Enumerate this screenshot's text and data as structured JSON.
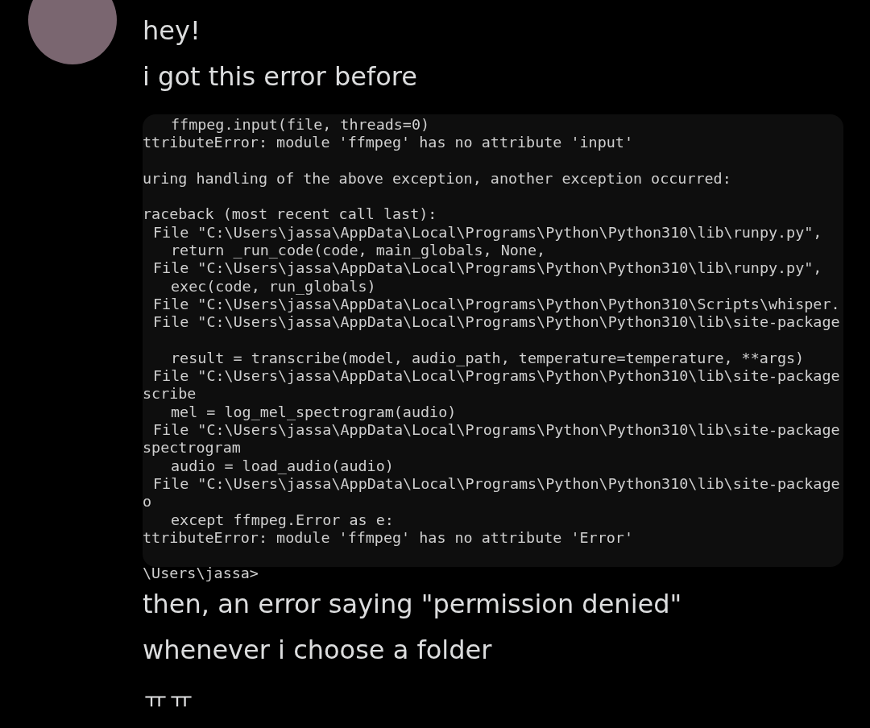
{
  "messages": [
    {
      "kind": "text",
      "text": "hey!"
    },
    {
      "kind": "text",
      "text": "i got this error before"
    },
    {
      "kind": "image",
      "lines": [
        {
          "kind": "code",
          "text": "ffmpeg.input(file, threads=0)"
        },
        {
          "kind": "plain",
          "text": "ttributeError: module 'ffmpeg' has no attribute 'input'"
        },
        {
          "kind": "blank"
        },
        {
          "kind": "plain",
          "text": "uring handling of the above exception, another exception occurred:"
        },
        {
          "kind": "blank"
        },
        {
          "kind": "plain",
          "text": "raceback (most recent call last):"
        },
        {
          "kind": "frame",
          "text": "File \"C:\\Users\\jassa\\AppData\\Local\\Programs\\Python\\Python310\\lib\\runpy.py\","
        },
        {
          "kind": "code",
          "text": "return _run_code(code, main_globals, None,"
        },
        {
          "kind": "frame",
          "text": "File \"C:\\Users\\jassa\\AppData\\Local\\Programs\\Python\\Python310\\lib\\runpy.py\","
        },
        {
          "kind": "code",
          "text": "exec(code, run_globals)"
        },
        {
          "kind": "frame",
          "text": "File \"C:\\Users\\jassa\\AppData\\Local\\Programs\\Python\\Python310\\Scripts\\whisper."
        },
        {
          "kind": "frame",
          "text": "File \"C:\\Users\\jassa\\AppData\\Local\\Programs\\Python\\Python310\\lib\\site-package"
        },
        {
          "kind": "blank"
        },
        {
          "kind": "code",
          "text": "result = transcribe(model, audio_path, temperature=temperature, **args)"
        },
        {
          "kind": "frame",
          "text": "File \"C:\\Users\\jassa\\AppData\\Local\\Programs\\Python\\Python310\\lib\\site-package"
        },
        {
          "kind": "plain",
          "text": "scribe"
        },
        {
          "kind": "code",
          "text": "mel = log_mel_spectrogram(audio)"
        },
        {
          "kind": "frame",
          "text": "File \"C:\\Users\\jassa\\AppData\\Local\\Programs\\Python\\Python310\\lib\\site-package"
        },
        {
          "kind": "plain",
          "text": "spectrogram"
        },
        {
          "kind": "code",
          "text": "audio = load_audio(audio)"
        },
        {
          "kind": "frame",
          "text": "File \"C:\\Users\\jassa\\AppData\\Local\\Programs\\Python\\Python310\\lib\\site-package"
        },
        {
          "kind": "plain",
          "text": "o"
        },
        {
          "kind": "code",
          "text": "except ffmpeg.Error as e:"
        },
        {
          "kind": "plain",
          "text": "ttributeError: module 'ffmpeg' has no attribute 'Error'"
        },
        {
          "kind": "blank"
        },
        {
          "kind": "plain",
          "text": "\\Users\\jassa>"
        }
      ]
    },
    {
      "kind": "text",
      "text": "then, an error saying \"permission denied\""
    },
    {
      "kind": "text",
      "text": "whenever i choose a folder"
    },
    {
      "kind": "text",
      "text": "ㅠㅠ"
    }
  ]
}
